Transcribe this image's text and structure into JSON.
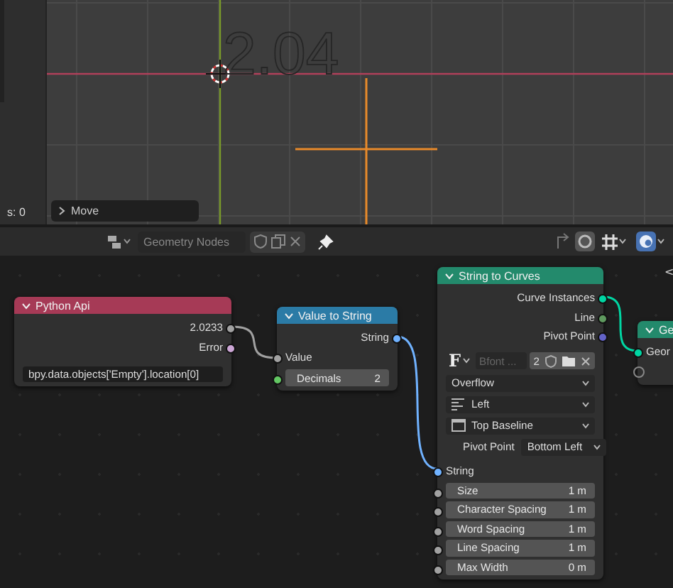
{
  "viewport": {
    "text_object": "2.04",
    "side_label": "s: 0",
    "last_operator": "Move"
  },
  "header": {
    "node_tree": "Geometry Nodes",
    "pinned": true
  },
  "nodes": [
    {
      "title": "Python Api",
      "color": "#a63a56",
      "rows": [
        {
          "kind": "output",
          "label": "2.0233",
          "color": "#a1a1a1"
        },
        {
          "kind": "output",
          "label": "Error",
          "color": "#cca6d6"
        },
        {
          "kind": "text",
          "value": "bpy.data.objects['Empty'].location[0]"
        }
      ]
    },
    {
      "title": "Value to String",
      "color": "#2b7ba6",
      "rows": [
        {
          "kind": "output",
          "label": "String",
          "color": "#70b2ff"
        },
        {
          "kind": "input",
          "label": "Value",
          "color": "#a1a1a1"
        },
        {
          "kind": "value",
          "label": "Decimals",
          "value": "2",
          "color": "#63c763"
        }
      ]
    },
    {
      "title": "String to Curves",
      "color": "#238a6c",
      "rows": [
        {
          "kind": "output",
          "label": "Curve Instances",
          "color": "#00d6a3"
        },
        {
          "kind": "output",
          "label": "Line",
          "color": "#5f9a5f"
        },
        {
          "kind": "output",
          "label": "Pivot Point",
          "color": "#6363c7"
        },
        {
          "kind": "font",
          "glyph": "F",
          "font_name": "Bfont ...",
          "users": "2"
        },
        {
          "kind": "dropdown",
          "value": "Overflow"
        },
        {
          "kind": "align",
          "value": "Left"
        },
        {
          "kind": "baseline",
          "value": "Top Baseline"
        },
        {
          "kind": "pivot",
          "label": "Pivot Point",
          "value": "Bottom Left"
        },
        {
          "kind": "input",
          "label": "String",
          "color": "#70b2ff"
        },
        {
          "kind": "value",
          "label": "Size",
          "value": "1 m",
          "color": "#a1a1a1"
        },
        {
          "kind": "value",
          "label": "Character Spacing",
          "value": "1 m",
          "color": "#a1a1a1"
        },
        {
          "kind": "value",
          "label": "Word Spacing",
          "value": "1 m",
          "color": "#a1a1a1"
        },
        {
          "kind": "value",
          "label": "Line Spacing",
          "value": "1 m",
          "color": "#a1a1a1"
        },
        {
          "kind": "value",
          "label": "Max Width",
          "value": "0 m",
          "color": "#a1a1a1"
        }
      ]
    },
    {
      "title": "Ge",
      "color": "#238a6c",
      "rows": [
        {
          "kind": "input",
          "label": "Geor",
          "color": "#00d6a3"
        },
        {
          "kind": "virtual"
        }
      ]
    }
  ],
  "corner_mark": "<"
}
